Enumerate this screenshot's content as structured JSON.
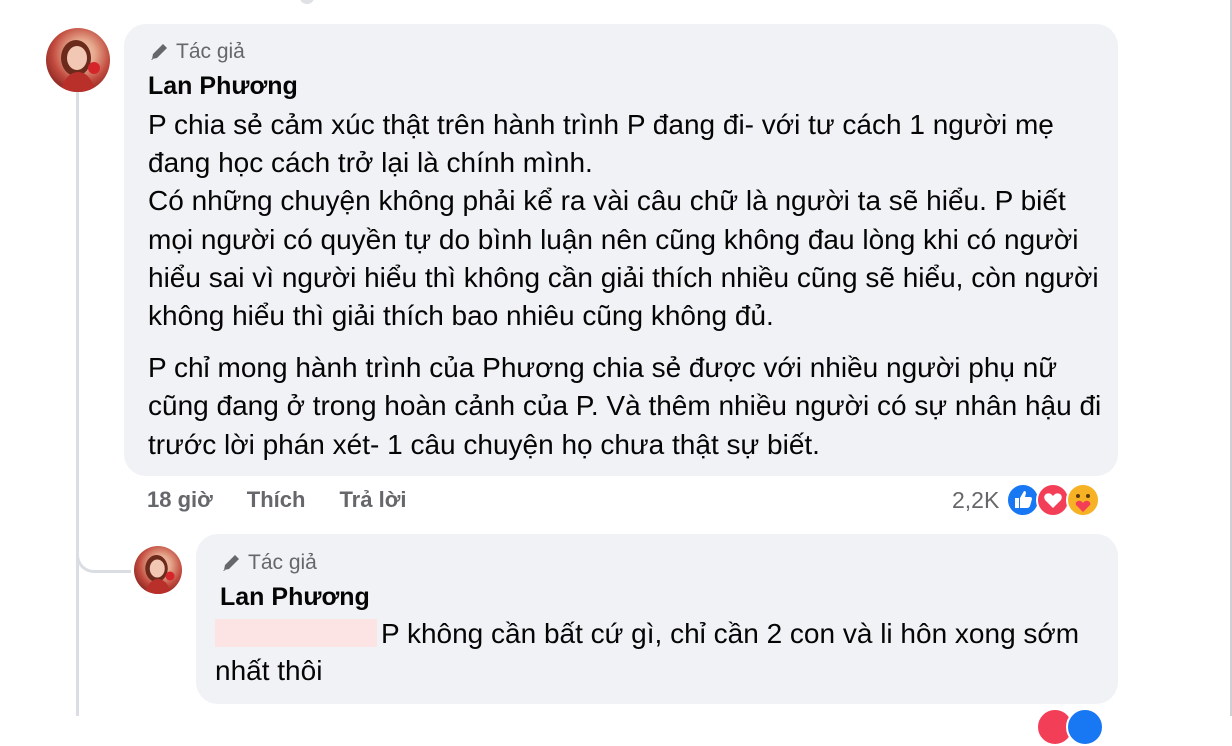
{
  "main_comment": {
    "author_badge": "Tác giả",
    "author_name": "Lan Phương",
    "paragraphs": [
      "P chia sẻ cảm xúc thật trên hành trình P đang đi- với tư cách 1 người mẹ đang học cách trở lại là chính mình.\nCó những chuyện không phải kể ra vài câu chữ là người ta sẽ hiểu. P biết mọi người có quyền tự do bình luận nên cũng không đau lòng khi có người hiểu sai vì người hiểu thì không cần giải thích nhiều cũng sẽ hiểu, còn người không hiểu thì giải thích bao nhiêu cũng không đủ.",
      "P chỉ mong hành trình của Phương chia sẻ được với nhiều người phụ nữ cũng đang ở trong hoàn cảnh của P. Và thêm nhiều người có sự nhân hậu đi trước lời phán xét- 1 câu chuyện họ chưa thật sự biết."
    ],
    "time": "18 giờ",
    "like_label": "Thích",
    "reply_label": "Trả lời",
    "reaction_count": "2,2K",
    "reaction_icons": [
      "like-icon",
      "love-icon",
      "care-icon"
    ]
  },
  "reply_comment": {
    "author_badge": "Tác giả",
    "author_name": "Lan Phương",
    "text": "P không cần bất cứ gì, chỉ cần 2 con và li hôn xong sớm nhất thôi"
  },
  "colors": {
    "bubble": "#f0f2f5",
    "secondary_text": "#65676b",
    "like_blue": "#1877f2",
    "love_red": "#f33e58",
    "care_yellow": "#f7b125"
  }
}
